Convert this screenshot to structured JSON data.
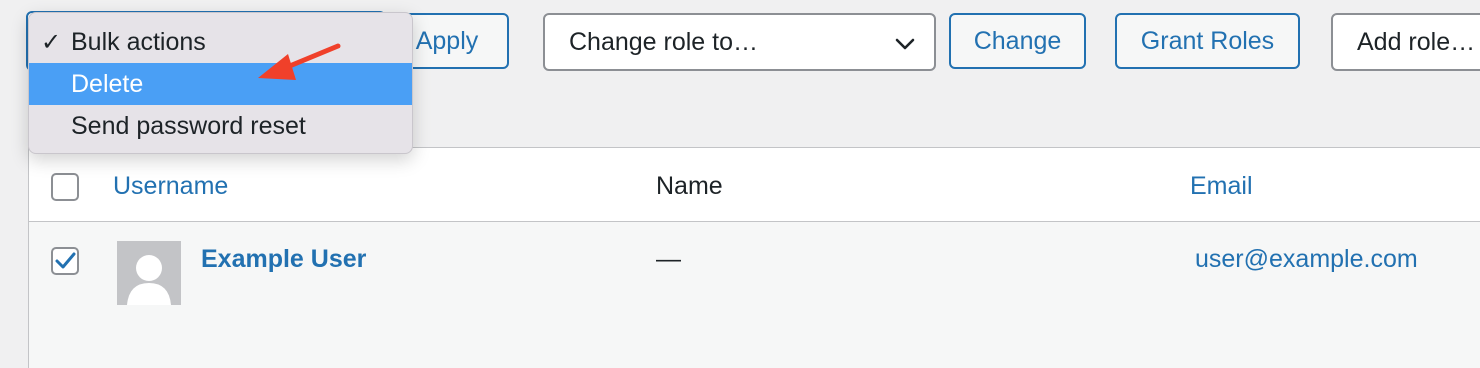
{
  "toolbar": {
    "apply_label": "Apply",
    "change_role_placeholder": "Change role to…",
    "change_label": "Change",
    "grant_roles_label": "Grant Roles",
    "add_role_placeholder": "Add role…"
  },
  "bulk_dropdown": {
    "options": [
      {
        "label": "Bulk actions",
        "checked": true
      },
      {
        "label": "Delete",
        "highlighted": true
      },
      {
        "label": "Send password reset"
      }
    ]
  },
  "table": {
    "columns": [
      "Username",
      "Name",
      "Email"
    ],
    "rows": [
      {
        "checked": true,
        "username": "Example User",
        "name": "—",
        "email": "user@example.com"
      }
    ]
  },
  "colors": {
    "accent": "#2271b1",
    "highlight": "#4a9ff5",
    "annotation_arrow": "#f0402a"
  }
}
